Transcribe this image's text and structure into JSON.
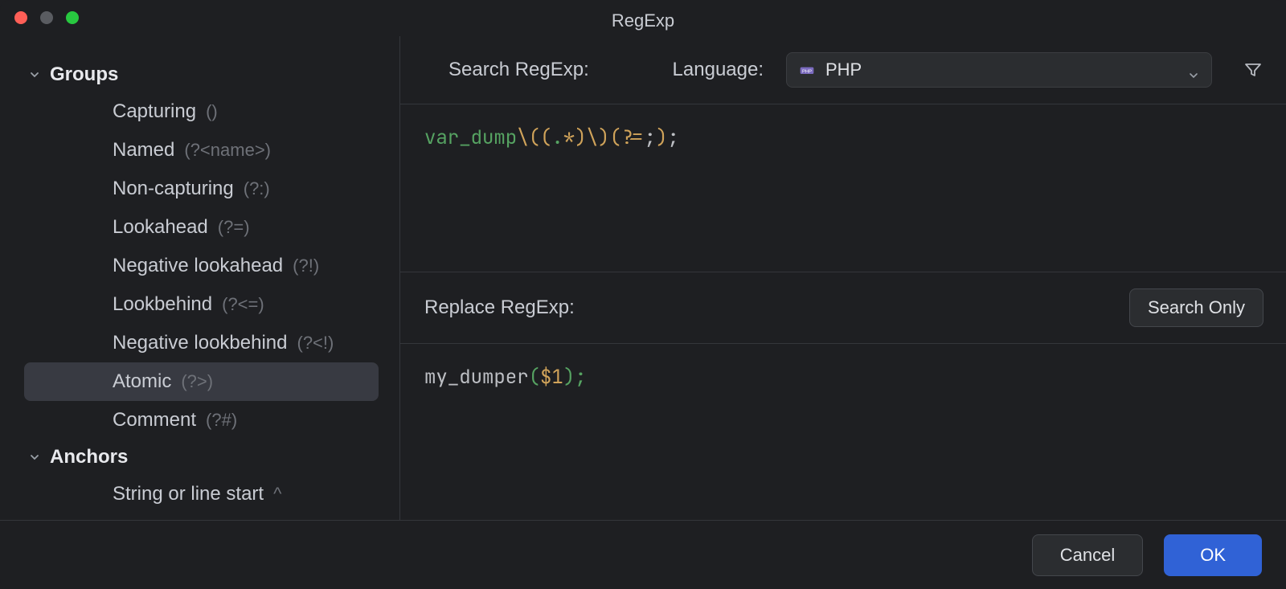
{
  "window": {
    "title": "RegExp"
  },
  "toolbar": {
    "search_label": "Search RegExp:",
    "language_label": "Language:",
    "language_value": "PHP"
  },
  "sidebar": {
    "groups": [
      {
        "title": "Groups",
        "expanded": true,
        "items": [
          {
            "label": "Capturing",
            "syntax": "()"
          },
          {
            "label": "Named",
            "syntax": "(?<name>)"
          },
          {
            "label": "Non-capturing",
            "syntax": "(?:)"
          },
          {
            "label": "Lookahead",
            "syntax": "(?=)"
          },
          {
            "label": "Negative lookahead",
            "syntax": "(?!)"
          },
          {
            "label": "Lookbehind",
            "syntax": "(?<=)"
          },
          {
            "label": "Negative lookbehind",
            "syntax": "(?<!)"
          },
          {
            "label": "Atomic",
            "syntax": "(?>)",
            "selected": true
          },
          {
            "label": "Comment",
            "syntax": "(?#)"
          }
        ]
      },
      {
        "title": "Anchors",
        "expanded": true,
        "items": [
          {
            "label": "String or line start",
            "syntax": "^"
          }
        ]
      }
    ]
  },
  "search_regexp": {
    "tokens": [
      {
        "t": "var_dump",
        "c": "fn"
      },
      {
        "t": "\\(",
        "c": "esc"
      },
      {
        "t": "(",
        "c": "grp"
      },
      {
        "t": ".",
        "c": "any"
      },
      {
        "t": "*",
        "c": "qt"
      },
      {
        "t": ")",
        "c": "grp"
      },
      {
        "t": "\\)",
        "c": "esc"
      },
      {
        "t": "(?=",
        "c": "lk"
      },
      {
        "t": ";",
        "c": "txt"
      },
      {
        "t": ")",
        "c": "lk"
      },
      {
        "t": ";",
        "c": "txt"
      }
    ]
  },
  "replace": {
    "label": "Replace RegExp:",
    "search_only_button": "Search Only",
    "tokens": [
      {
        "t": "my_dumper",
        "c": "id"
      },
      {
        "t": "(",
        "c": "par"
      },
      {
        "t": "$1",
        "c": "var"
      },
      {
        "t": ")",
        "c": "par"
      },
      {
        "t": ";",
        "c": "sc"
      }
    ]
  },
  "footer": {
    "cancel": "Cancel",
    "ok": "OK"
  }
}
